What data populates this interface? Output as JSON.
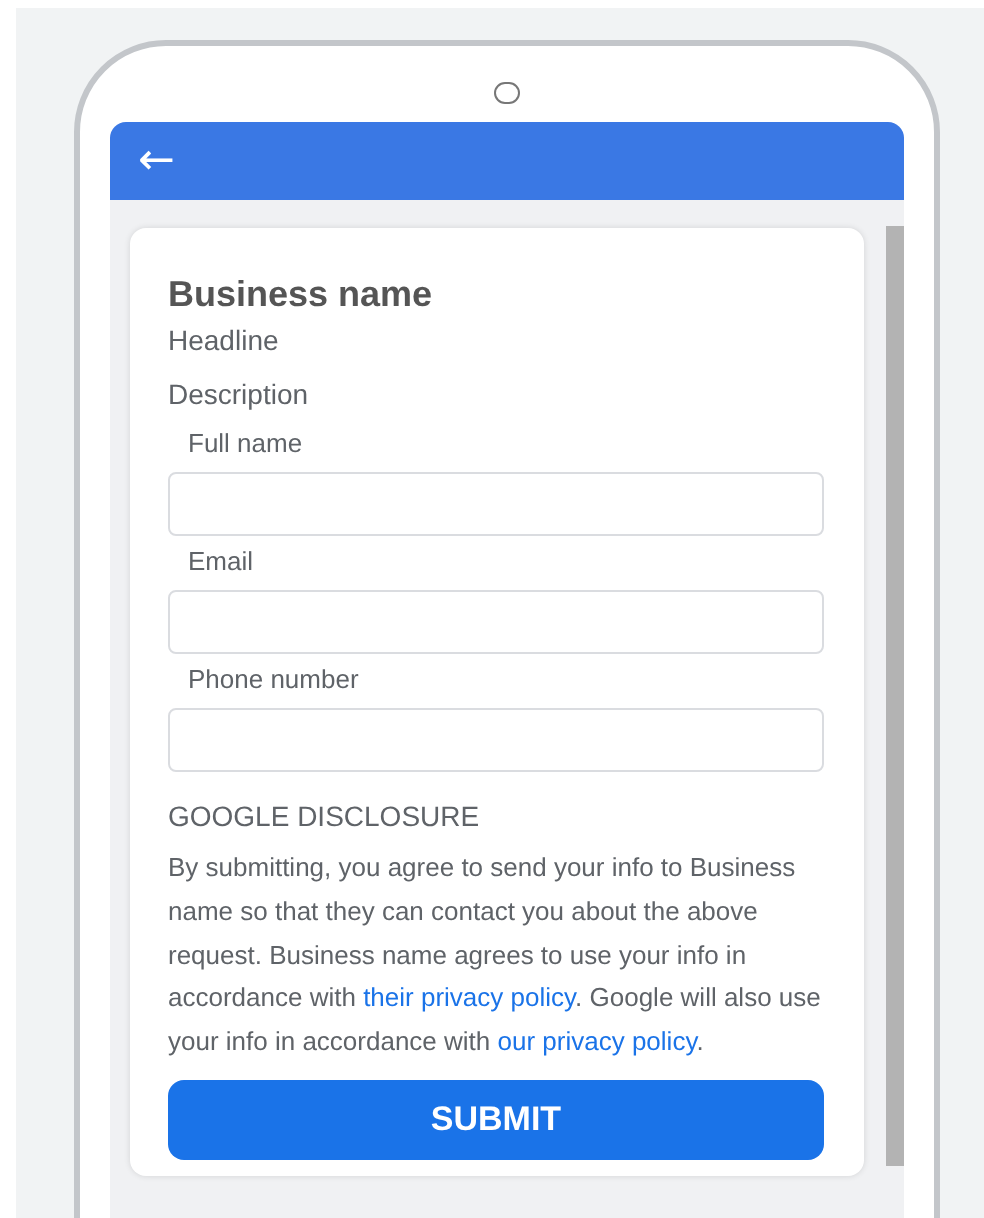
{
  "app_bar": {
    "back": "←"
  },
  "business": {
    "name": "Business name",
    "headline": "Headline",
    "description": "Description"
  },
  "fields": [
    {
      "label": "Full name"
    },
    {
      "label": "Email"
    },
    {
      "label": "Phone number"
    }
  ],
  "disclosure": {
    "title": "GOOGLE DISCLOSURE",
    "segments": [
      {
        "kind": "text",
        "text": "By submitting, you agree to send your info to Business name so that they can contact you about the above request. Business name agrees to use your info in accordance with "
      },
      {
        "kind": "link",
        "text": "their privacy policy"
      },
      {
        "kind": "text",
        "text": ". Google will also use your info in accordance with "
      },
      {
        "kind": "link",
        "text": "our privacy policy"
      },
      {
        "kind": "text",
        "text": "."
      }
    ]
  },
  "submit": "SUBMIT"
}
